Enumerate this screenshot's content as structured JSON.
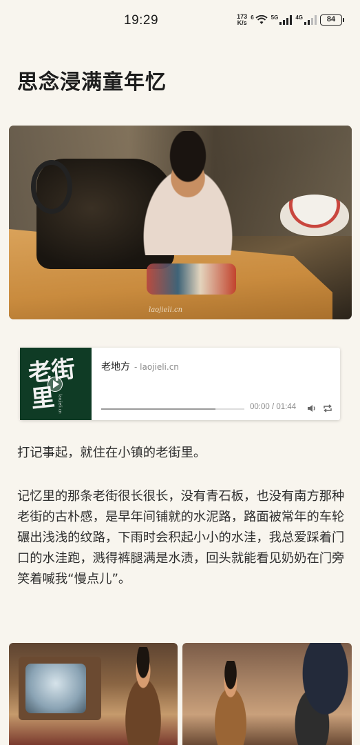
{
  "status_bar": {
    "time": "19:29",
    "net_speed_value": "173",
    "net_speed_unit": "K/s",
    "wifi_label": "6",
    "sim1_label": "5G",
    "sim2_label": "4G",
    "battery": "84"
  },
  "article": {
    "title": "思念浸满童年忆",
    "paragraphs": [
      "打记事起，就住在小镇的老街里。",
      "记忆里的那条老街很长很长，没有青石板，也没有南方那种老街的古朴感，是早年间铺就的水泥路，路面被常年的车轮碾出浅浅的纹路，下雨时会积起小小的水洼，我总爱踩着门口的水洼跑，溅得裤腿满是水渍，回头就能看见奶奶在门旁笑着喊我“慢点儿”。"
    ],
    "hero_watermark": "laojieli.cn"
  },
  "player": {
    "cover_text": "老街里",
    "cover_sub": "laojieli.cn",
    "song_title": "老地方",
    "source": "- laojieli.cn",
    "time_readout": "00:00 / 01:44",
    "progress": 0.8
  },
  "icons": {
    "volume": "volume-icon",
    "loop": "loop-icon",
    "wifi": "wifi-icon",
    "signal": "signal-icon"
  }
}
